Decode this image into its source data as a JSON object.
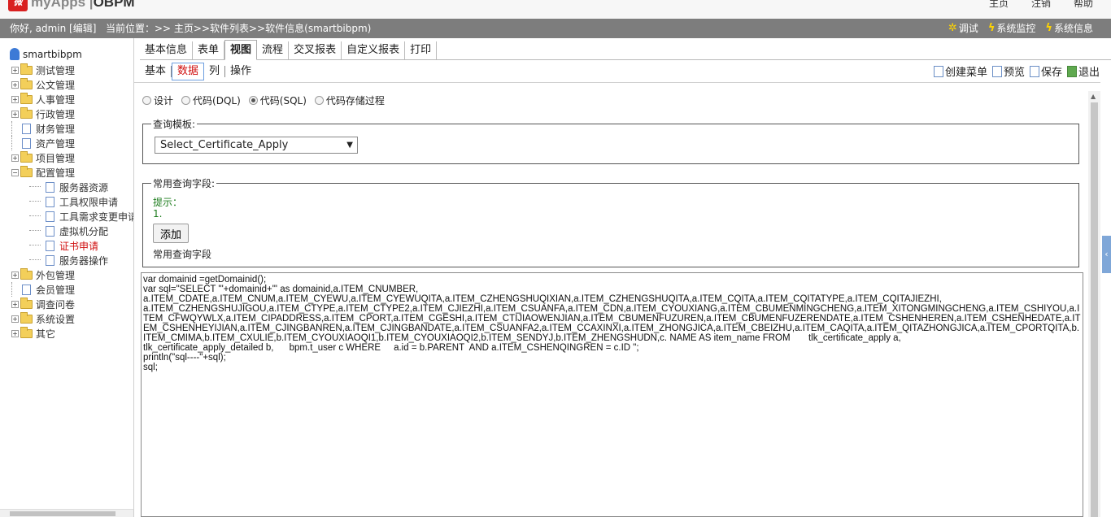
{
  "header": {
    "logo_text": "myApps",
    "brand": "OBPM",
    "links": [
      "主页",
      "注销",
      "帮助"
    ]
  },
  "infobar": {
    "greeting": "你好, admin [编辑]",
    "location": "当前位置：>> 主页>>软件列表>>软件信息(smartbibpm)",
    "tools": [
      "调试",
      "系统监控",
      "系统信息"
    ]
  },
  "sidebar": {
    "root": "smartbibpm",
    "items": [
      {
        "label": "测试管理",
        "type": "folder"
      },
      {
        "label": "公文管理",
        "type": "folder"
      },
      {
        "label": "人事管理",
        "type": "folder"
      },
      {
        "label": "行政管理",
        "type": "folder"
      },
      {
        "label": "财务管理",
        "type": "doc"
      },
      {
        "label": "资产管理",
        "type": "doc"
      },
      {
        "label": "项目管理",
        "type": "folder"
      },
      {
        "label": "配置管理",
        "type": "folder-open"
      },
      {
        "label": "服务器资源",
        "type": "child"
      },
      {
        "label": "工具权限申请",
        "type": "child"
      },
      {
        "label": "工具需求变更申请",
        "type": "child"
      },
      {
        "label": "虚拟机分配",
        "type": "child"
      },
      {
        "label": "证书申请",
        "type": "child-active"
      },
      {
        "label": "服务器操作",
        "type": "child"
      },
      {
        "label": "外包管理",
        "type": "folder"
      },
      {
        "label": "会员管理",
        "type": "doc"
      },
      {
        "label": "调查问卷",
        "type": "folder"
      },
      {
        "label": "系统设置",
        "type": "folder"
      },
      {
        "label": "其它",
        "type": "folder"
      }
    ]
  },
  "tabs": [
    "基本信息",
    "表单",
    "视图",
    "流程",
    "交叉报表",
    "自定义报表",
    "打印"
  ],
  "subtabs": [
    "基本",
    "数据",
    "列",
    "操作"
  ],
  "actions": [
    "创建菜单",
    "预览",
    "保存",
    "退出"
  ],
  "modes": [
    "设计",
    "代码(DQL)",
    "代码(SQL)",
    "代码存储过程"
  ],
  "template": {
    "legend": "查询模板:",
    "selected": "Select_Certificate_Apply"
  },
  "fields": {
    "legend": "常用查询字段:",
    "hint_label": "提示：",
    "hint_item": "1.",
    "add_label": "添加",
    "caption": "常用查询字段"
  },
  "code": "var domainid =getDomainid();\nvar sql=\"SELECT '\"+domainid+\"' as domainid,a.ITEM_CNUMBER,\na.ITEM_CDATE,a.ITEM_CNUM,a.ITEM_CYEWU,a.ITEM_CYEWUQITA,a.ITEM_CZHENGSHUQIXIAN,a.ITEM_CZHENGSHUQITA,a.ITEM_CQITA,a.ITEM_CQITATYPE,a.ITEM_CQITAJIEZHI,\na.ITEM_CZHENGSHUJIGOU,a.ITEM_CTYPE,a.ITEM_CTYPE2,a.ITEM_CJIEZHI,a.ITEM_CSUANFA,a.ITEM_CDN,a.ITEM_CYOUXIANG,a.ITEM_CBUMENMINGCHENG,a.ITEM_XITONGMINGCHENG,a.ITEM_CSHIYOU,a.ITEM_CFWQYWLX,a.ITEM_CIPADDRESS,a.ITEM_CPORT,a.ITEM_CGESHI,a.ITEM_CTIJIAOWENJIAN,a.ITEM_CBUMENFUZUREN,a.ITEM_CBUMENFUZERENDATE,a.ITEM_CSHENHEREN,a.ITEM_CSHENHEDATE,a.ITEM_CSHENHEYIJIAN,a.ITEM_CJINGBANREN,a.ITEM_CJINGBANDATE,a.ITEM_CSUANFA2,a.ITEM_CCAXINXI,a.ITEM_ZHONGJICA,a.ITEM_CBEIZHU,a.ITEM_CAQITA,a.ITEM_QITAZHONGJICA,a.ITEM_CPORTQITA,b.ITEM_CMIMA,b.ITEM_CXULIE,b.ITEM_CYOUXIAOQI1,b.ITEM_CYOUXIAOQI2,b.ITEM_SENDYJ,b.ITEM_ZHENGSHUDN,c. NAME AS item_name FROM       tlk_certificate_apply a,\ntlk_certificate_apply_detailed b,      bpm.t_user c WHERE     a.id = b.PARENT  AND a.ITEM_CSHENQINGREN = c.ID \";\nprintln(\"sql----\"+sql);\nsql;"
}
